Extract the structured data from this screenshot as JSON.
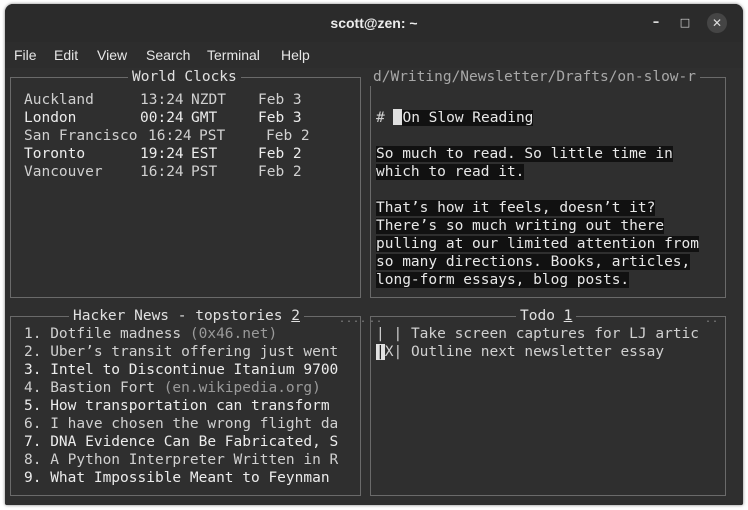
{
  "window": {
    "title": "scott@zen: ~"
  },
  "menu": [
    "File",
    "Edit",
    "View",
    "Search",
    "Terminal",
    "Help"
  ],
  "world_clocks": {
    "title": "World Clocks",
    "rows": [
      {
        "city": "Auckland",
        "time": "13:24",
        "tz": "NZDT",
        "date": "Feb 3",
        "highlight": false
      },
      {
        "city": "London",
        "time": "00:24",
        "tz": "GMT",
        "date": "Feb 3",
        "highlight": true
      },
      {
        "city": "San Francisco",
        "time": "16:24",
        "tz": "PST",
        "date": "Feb 2",
        "highlight": false
      },
      {
        "city": "Toronto",
        "time": "19:24",
        "tz": "EST",
        "date": "Feb 2",
        "highlight": true
      },
      {
        "city": "Vancouver",
        "time": "16:24",
        "tz": "PST",
        "date": "Feb 2",
        "highlight": false
      }
    ]
  },
  "editor": {
    "path": "d/Writing/Newsletter/Drafts/on-slow-r",
    "heading_marker": "#",
    "heading": "On Slow Reading",
    "lines": [
      "So much to read. So little time in",
      "which to read it.",
      "",
      "That’s how it feels, doesn’t it?",
      "There’s so much writing out there",
      "pulling at our limited attention from",
      "so many directions. Books, articles,",
      "long-form essays, blog posts."
    ]
  },
  "hacker_news": {
    "title": "Hacker News - topstories",
    "count": "2",
    "items": [
      {
        "num": "1.",
        "title": "Dotfile madness",
        "domain": "(0x46.net)"
      },
      {
        "num": "2.",
        "title": "Uber’s transit offering just went",
        "domain": ""
      },
      {
        "num": "3.",
        "title": "Intel to Discontinue Itanium 9700",
        "domain": ""
      },
      {
        "num": "4.",
        "title": "Bastion Fort",
        "domain": "(en.wikipedia.org)"
      },
      {
        "num": "5.",
        "title": "How transportation can transform",
        "domain": ""
      },
      {
        "num": "6.",
        "title": "I have chosen the wrong flight da",
        "domain": ""
      },
      {
        "num": "7.",
        "title": "DNA Evidence Can Be Fabricated, S",
        "domain": ""
      },
      {
        "num": "8.",
        "title": "A Python Interpreter Written in R",
        "domain": ""
      },
      {
        "num": "9.",
        "title": "What Impossible Meant to Feynman",
        "domain": ""
      }
    ]
  },
  "todo": {
    "title": "Todo",
    "count": "1",
    "items": [
      {
        "box_left": "|",
        "box_mark": " ",
        "box_right": "|",
        "text": "Take screen captures for LJ artic"
      },
      {
        "box_left": "|",
        "box_mark": "X",
        "box_right": "|",
        "text": "Outline next newsletter essay"
      }
    ]
  }
}
